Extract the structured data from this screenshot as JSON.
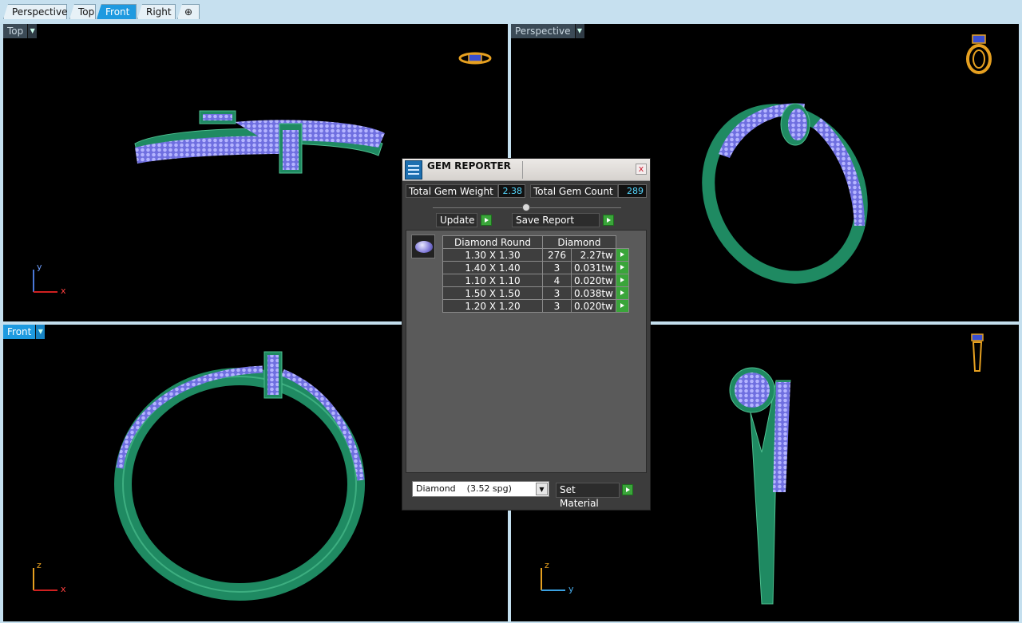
{
  "tabs": [
    {
      "label": "Perspective",
      "active": false
    },
    {
      "label": "Top",
      "active": false
    },
    {
      "label": "Front",
      "active": true
    },
    {
      "label": "Right",
      "active": false
    },
    {
      "label": "⊕",
      "active": false
    }
  ],
  "viewports": {
    "top": {
      "label": "Top",
      "axes": [
        "y",
        "x"
      ]
    },
    "perspective": {
      "label": "Perspective"
    },
    "front": {
      "label": "Front",
      "axes": [
        "z",
        "x"
      ]
    },
    "right": {
      "axes": [
        "z",
        "y"
      ]
    }
  },
  "gem_reporter": {
    "title": "GEM REPORTER",
    "close_label": "x",
    "total_weight_label": "Total Gem Weight",
    "total_weight_value": "2.38",
    "total_count_label": "Total Gem Count",
    "total_count_value": "289",
    "update_label": "Update",
    "save_report_label": "Save Report",
    "table": {
      "headers": [
        "Diamond Round",
        "Diamond"
      ],
      "rows": [
        {
          "size": "1.30 X 1.30",
          "count": "276",
          "weight": "2.27tw"
        },
        {
          "size": "1.40 X 1.40",
          "count": "3",
          "weight": "0.031tw"
        },
        {
          "size": "1.10 X 1.10",
          "count": "4",
          "weight": "0.020tw"
        },
        {
          "size": "1.50 X 1.50",
          "count": "3",
          "weight": "0.038tw"
        },
        {
          "size": "1.20 X 1.20",
          "count": "3",
          "weight": "0.020tw"
        }
      ]
    },
    "material_value": "Diamond    (3.52 spg)",
    "set_material_label": "Set Material"
  },
  "colors": {
    "viewport_bg": "#000000",
    "ring_green": "#1f8a62",
    "pave_blue": "#8c8cf0",
    "active_tab": "#1e9ae0",
    "nav_gold": "#e6a020"
  }
}
